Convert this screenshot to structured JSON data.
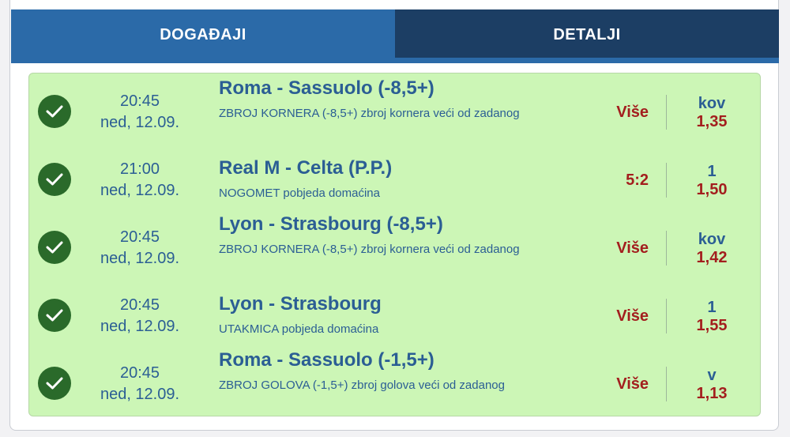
{
  "tabs": {
    "events_label": "DOGAĐAJI",
    "details_label": "DETALJI"
  },
  "events": [
    {
      "status": "check-icon",
      "time": "20:45",
      "date": "ned, 12.09.",
      "title": "Roma - Sassuolo (-8,5+)",
      "description": "ZBROJ KORNERA (-8,5+) zbroj kornera veći od zadanog",
      "pick": "Više",
      "odds_type": "kov",
      "odds_value": "1,35"
    },
    {
      "status": "check-icon",
      "time": "21:00",
      "date": "ned, 12.09.",
      "title": "Real M - Celta (P.P.)",
      "description": "NOGOMET pobjeda domaćina",
      "pick": "5:2",
      "odds_type": "1",
      "odds_value": "1,50"
    },
    {
      "status": "check-icon",
      "time": "20:45",
      "date": "ned, 12.09.",
      "title": "Lyon - Strasbourg (-8,5+)",
      "description": "ZBROJ KORNERA (-8,5+) zbroj kornera veći od zadanog",
      "pick": "Više",
      "odds_type": "kov",
      "odds_value": "1,42"
    },
    {
      "status": "check-icon",
      "time": "20:45",
      "date": "ned, 12.09.",
      "title": "Lyon - Strasbourg",
      "description": "UTAKMICA pobjeda domaćina",
      "pick": "Više",
      "odds_type": "1",
      "odds_value": "1,55"
    },
    {
      "status": "check-icon",
      "time": "20:45",
      "date": "ned, 12.09.",
      "title": "Roma - Sassuolo (-1,5+)",
      "description": "ZBROJ GOLOVA (-1,5+) zbroj golova veći od zadanog",
      "pick": "Više",
      "odds_type": "v",
      "odds_value": "1,13"
    }
  ],
  "colors": {
    "tab_active": "#2b6aa8",
    "tab_inactive": "#1c3e64",
    "events_bg": "#ccf6b6",
    "check_bg": "#2a6a2a",
    "text_blue": "#2b5e94",
    "text_red": "#a31e1e"
  }
}
